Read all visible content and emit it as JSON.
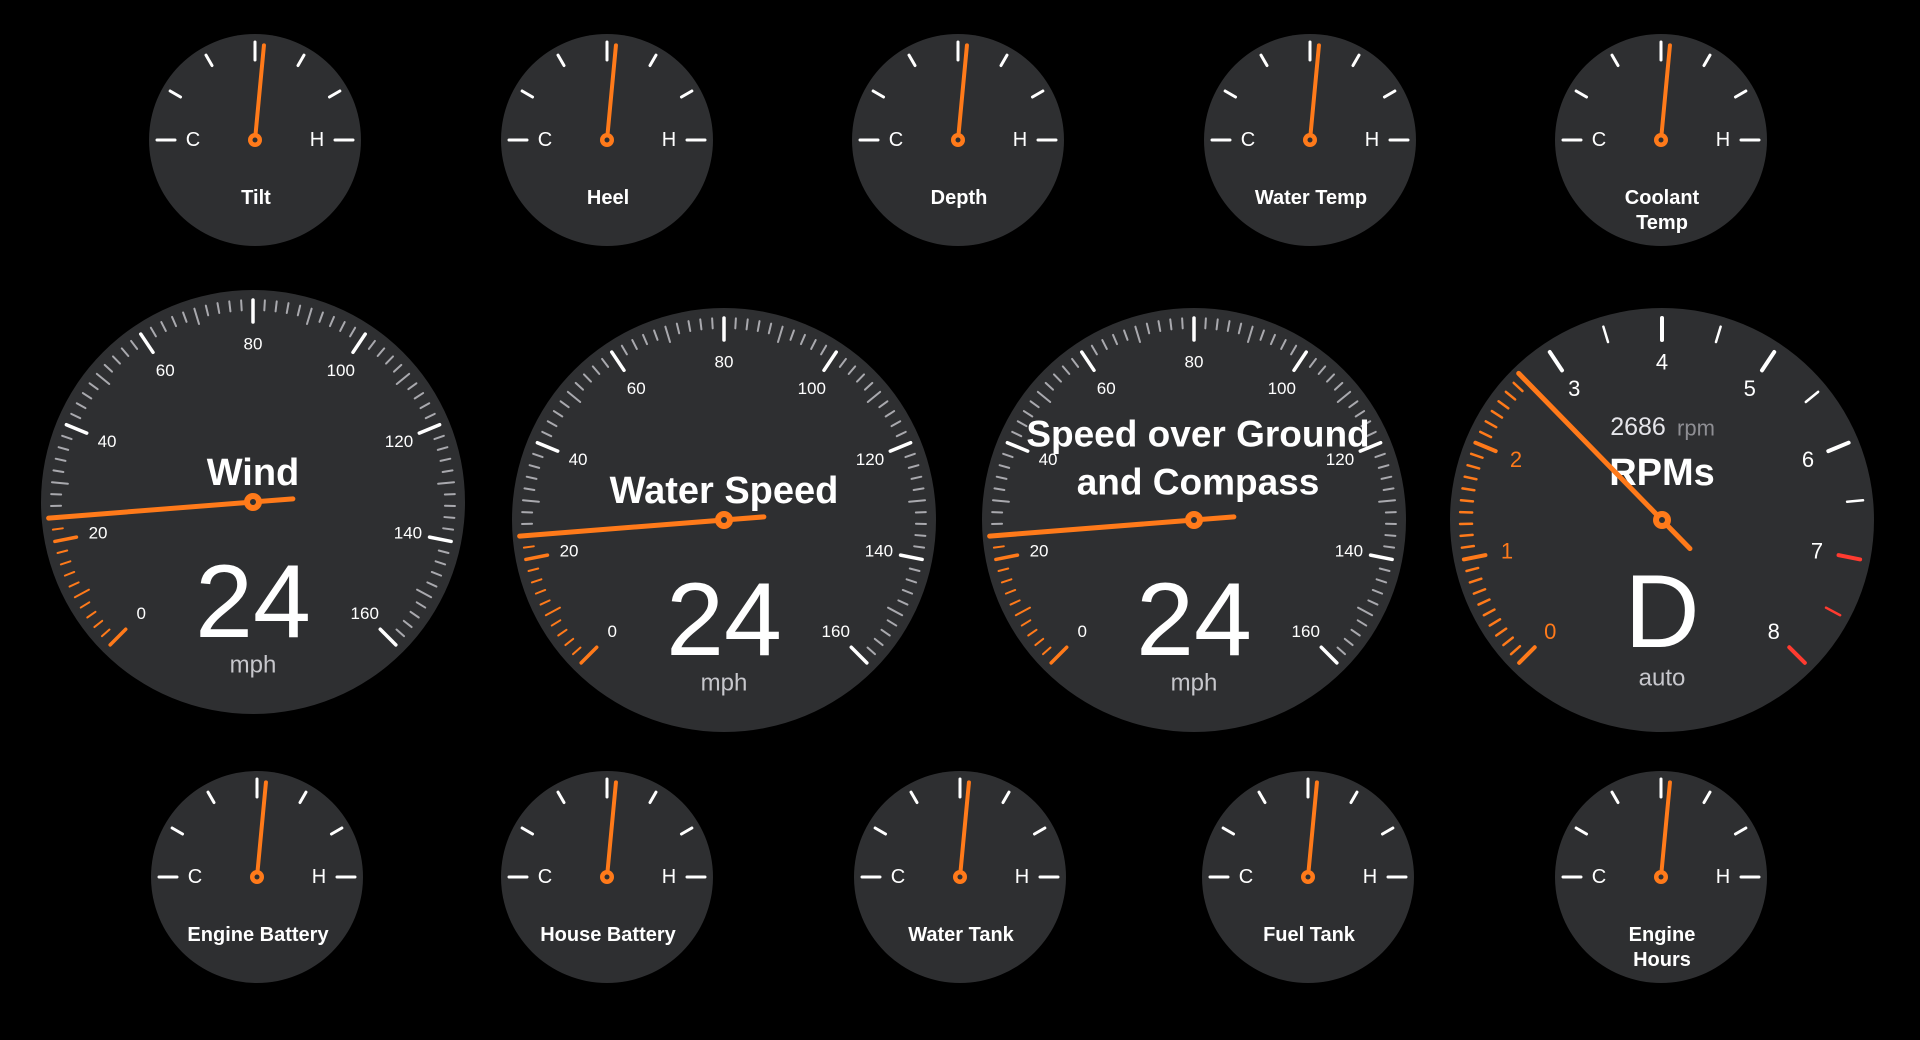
{
  "colors": {
    "background": "#000000",
    "gauge_face": "#2e2f31",
    "needle": "#ff7a1a",
    "redline": "#ff3b30",
    "tick": "#ffffff",
    "unit_text": "#c7c7cc"
  },
  "small_gauges": [
    {
      "title_lines": [
        "Tilt"
      ],
      "cold_label": "C",
      "hot_label": "H",
      "level": 0.53
    },
    {
      "title_lines": [
        "Heel"
      ],
      "cold_label": "C",
      "hot_label": "H",
      "level": 0.53
    },
    {
      "title_lines": [
        "Depth"
      ],
      "cold_label": "C",
      "hot_label": "H",
      "level": 0.53
    },
    {
      "title_lines": [
        "Water Temp"
      ],
      "cold_label": "C",
      "hot_label": "H",
      "level": 0.53
    },
    {
      "title_lines": [
        "Coolant",
        "Temp"
      ],
      "cold_label": "C",
      "hot_label": "H",
      "level": 0.53
    },
    {
      "title_lines": [
        "Engine Battery"
      ],
      "cold_label": "C",
      "hot_label": "H",
      "level": 0.53
    },
    {
      "title_lines": [
        "House Battery"
      ],
      "cold_label": "C",
      "hot_label": "H",
      "level": 0.53
    },
    {
      "title_lines": [
        "Water Tank"
      ],
      "cold_label": "C",
      "hot_label": "H",
      "level": 0.53
    },
    {
      "title_lines": [
        "Fuel Tank"
      ],
      "cold_label": "C",
      "hot_label": "H",
      "level": 0.53
    },
    {
      "title_lines": [
        "Engine",
        "Hours"
      ],
      "cold_label": "C",
      "hot_label": "H",
      "level": 0.53
    }
  ],
  "speed_gauges": [
    {
      "title_lines": [
        "Wind"
      ],
      "value": "24",
      "unit": "mph",
      "needle_value": 24,
      "scale_labels": [
        "0",
        "20",
        "40",
        "60",
        "80",
        "100",
        "120",
        "140",
        "160"
      ]
    },
    {
      "title_lines": [
        "Water Speed"
      ],
      "value": "24",
      "unit": "mph",
      "needle_value": 24,
      "scale_labels": [
        "0",
        "20",
        "40",
        "60",
        "80",
        "100",
        "120",
        "140",
        "160"
      ]
    },
    {
      "title_lines": [
        "Speed over Ground",
        "and Compass"
      ],
      "value": "24",
      "unit": "mph",
      "needle_value": 24,
      "scale_labels": [
        "0",
        "20",
        "40",
        "60",
        "80",
        "100",
        "120",
        "140",
        "160"
      ]
    }
  ],
  "rpm_gauge": {
    "title": "RPMs",
    "rpm_value": "2686",
    "rpm_unit": "rpm",
    "gear": "D",
    "mode": "auto",
    "needle_value": 2.686,
    "scale_labels": [
      "0",
      "1",
      "2",
      "3",
      "4",
      "5",
      "6",
      "7",
      "8"
    ]
  }
}
